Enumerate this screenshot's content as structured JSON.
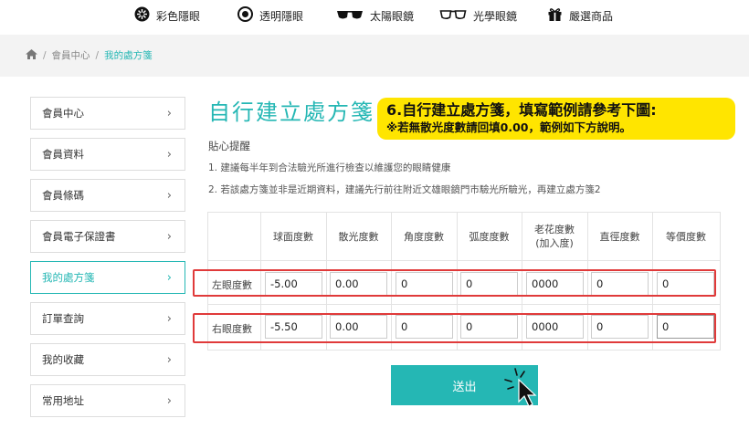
{
  "nav": {
    "items": [
      {
        "label": "彩色隱眼",
        "icon": "color-lens-icon"
      },
      {
        "label": "透明隱眼",
        "icon": "clear-lens-icon"
      },
      {
        "label": "太陽眼鏡",
        "icon": "sunglasses-icon"
      },
      {
        "label": "光學眼鏡",
        "icon": "optical-glasses-icon"
      },
      {
        "label": "嚴選商品",
        "icon": "gift-icon"
      }
    ]
  },
  "breadcrumb": {
    "home_icon": "home-icon",
    "separator": "/",
    "items": [
      "會員中心",
      "我的處方箋"
    ]
  },
  "sidebar": {
    "items": [
      {
        "label": "會員中心",
        "active": false
      },
      {
        "label": "會員資料",
        "active": false
      },
      {
        "label": "會員條碼",
        "active": false
      },
      {
        "label": "會員電子保證書",
        "active": false
      },
      {
        "label": "我的處方箋",
        "active": true
      },
      {
        "label": "訂單查詢",
        "active": false
      },
      {
        "label": "我的收藏",
        "active": false
      },
      {
        "label": "常用地址",
        "active": false
      }
    ],
    "chevron": "›"
  },
  "main": {
    "title": "自行建立處方箋",
    "callout": {
      "line1": "6.自行建立處方箋，填寫範例請參考下圖:",
      "line2": "※若無散光度數請回填0.00，範例如下方說明。"
    },
    "tips_title": "貼心提醒",
    "tips": [
      "1. 建議每半年到合法驗光所進行檢查以維護您的眼睛健康",
      "2. 若該處方箋並非是近期資料，建議先行前往附近文雄眼鏡門市驗光所驗光，再建立處方箋2"
    ]
  },
  "table": {
    "headers": [
      "球面度數",
      "散光度數",
      "角度度數",
      "弧度度數",
      "老花度數\n(加入度)",
      "直徑度數",
      "等價度數"
    ],
    "rows": [
      {
        "label": "左眼度數",
        "values": [
          "-5.00",
          "0.00",
          "0",
          "0",
          "0000",
          "0",
          "0"
        ]
      },
      {
        "label": "右眼度數",
        "values": [
          "-5.50",
          "0.00",
          "0",
          "0",
          "0000",
          "0",
          "0"
        ]
      }
    ]
  },
  "submit_label": "送出",
  "colors": {
    "accent": "#25b7b4",
    "callout": "#ffe500",
    "highlight": "#e03a3a"
  }
}
